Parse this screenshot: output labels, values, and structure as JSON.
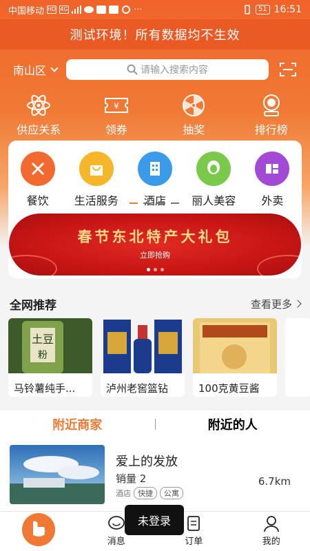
{
  "status_bar": {
    "carrier": "中国移动",
    "hd_badge": "HD",
    "network": "4G",
    "battery": "51",
    "time": "16:51"
  },
  "notice": {
    "text": "测试环境！所有数据均不生效"
  },
  "search_bar": {
    "city": "南山区",
    "placeholder": "请输入搜索内容"
  },
  "quick_actions": [
    {
      "label": "供应关系",
      "icon": "atom-icon"
    },
    {
      "label": "领券",
      "icon": "coupon-icon"
    },
    {
      "label": "抽奖",
      "icon": "lottery-wheel-icon"
    },
    {
      "label": "排行榜",
      "icon": "medal-icon"
    }
  ],
  "categories": [
    {
      "label": "餐饮",
      "icon": "cutlery-icon",
      "color": "#f26a30"
    },
    {
      "label": "生活服务",
      "icon": "shopping-bag-icon",
      "color": "#f4b72a"
    },
    {
      "label": "酒店",
      "icon": "building-icon",
      "color": "#3c9be8"
    },
    {
      "label": "丽人美容",
      "icon": "woman-icon",
      "color": "#7bc94a"
    },
    {
      "label": "外卖",
      "icon": "delivery-icon",
      "color": "#a24ad6"
    }
  ],
  "banner": {
    "title": "春节东北特产大礼包",
    "subtitle": "立即抢购"
  },
  "recommend": {
    "title": "全网推荐",
    "more": "查看更多",
    "products": [
      {
        "name": "马铃薯纯手..."
      },
      {
        "name": "泸州老窖篮钻"
      },
      {
        "name": "100克黄豆酱"
      }
    ]
  },
  "nearby_tabs": {
    "merchants": "附近商家",
    "people": "附近的人"
  },
  "shop": {
    "name": "爱上的发放",
    "sales": "销量 2",
    "type": "酒店",
    "tags": [
      "快捷",
      "公寓"
    ],
    "distance": "6.7km"
  },
  "toast": "未登录",
  "bottom_nav": {
    "message": "消息",
    "orders": "订单",
    "mine": "我的"
  },
  "colors": {
    "brand_orange": "#f07a35",
    "notice_bg": "#ea5a25"
  }
}
